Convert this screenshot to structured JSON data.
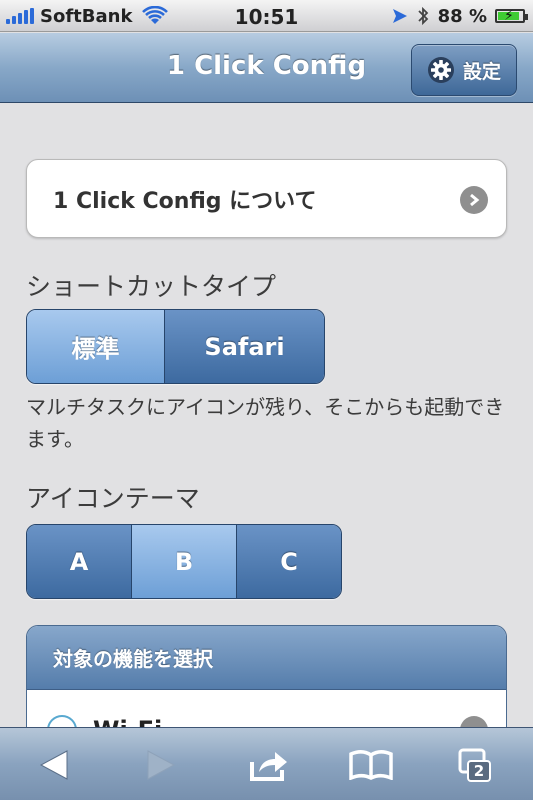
{
  "status_bar": {
    "carrier": "SoftBank",
    "time": "10:51",
    "battery_percent": "88 %",
    "battery_level": 0.88
  },
  "nav": {
    "title": "1 Click Config",
    "settings_label": "設定"
  },
  "about": {
    "label": "1 Click Config について"
  },
  "shortcut_type": {
    "label": "ショートカットタイプ",
    "options": [
      "標準",
      "Safari"
    ],
    "selected": "標準",
    "description": "マルチタスクにアイコンが残り、そこからも起動できます。"
  },
  "icon_theme": {
    "label": "アイコンテーマ",
    "options": [
      "A",
      "B",
      "C"
    ],
    "selected": "B"
  },
  "features": {
    "header": "対象の機能を選択",
    "first_item": "Wi-Fi"
  },
  "toolbar": {
    "tabs_count": "2"
  },
  "colors": {
    "nav_blue": "#6d90b6",
    "segment_blue": "#3d6aa0",
    "segment_selected": "#6d9fd6",
    "background": "#e1e1e3"
  }
}
